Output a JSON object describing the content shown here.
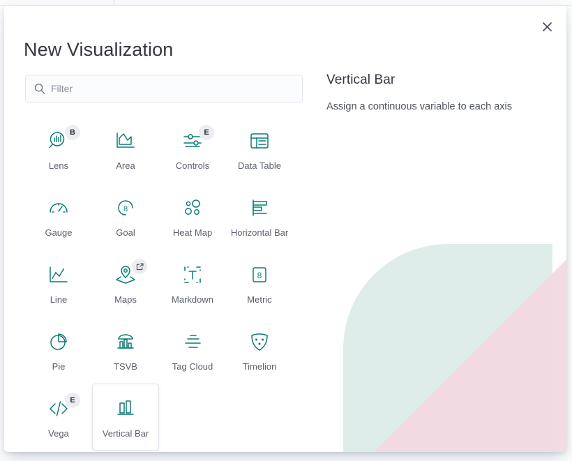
{
  "modal": {
    "title": "New Visualization",
    "close_label": "Close",
    "close_icon": "close-icon"
  },
  "search": {
    "placeholder": "Filter",
    "value": "",
    "icon": "search-icon"
  },
  "detail": {
    "title": "Vertical Bar",
    "description": "Assign a continuous variable to each axis"
  },
  "colors": {
    "accent_teal": "#0b7b72",
    "text_primary": "#343741",
    "text_secondary": "#5a5f6c",
    "badge_bg": "#ecedf1",
    "deco_mint": "#d7e9e4",
    "deco_pink": "#f3d7e0"
  },
  "types": [
    {
      "label": "Lens",
      "icon": "lens-icon",
      "badge": "B",
      "badge_kind": "letter",
      "selected": false
    },
    {
      "label": "Area",
      "icon": "area-icon",
      "badge": null,
      "badge_kind": null,
      "selected": false
    },
    {
      "label": "Controls",
      "icon": "controls-icon",
      "badge": "E",
      "badge_kind": "letter",
      "selected": false
    },
    {
      "label": "Data Table",
      "icon": "data-table-icon",
      "badge": null,
      "badge_kind": null,
      "selected": false
    },
    {
      "label": "Gauge",
      "icon": "gauge-icon",
      "badge": null,
      "badge_kind": null,
      "selected": false
    },
    {
      "label": "Goal",
      "icon": "goal-icon",
      "badge": null,
      "badge_kind": null,
      "selected": false
    },
    {
      "label": "Heat Map",
      "icon": "heat-map-icon",
      "badge": null,
      "badge_kind": null,
      "selected": false
    },
    {
      "label": "Horizontal Bar",
      "icon": "horizontal-bar-icon",
      "badge": null,
      "badge_kind": null,
      "selected": false
    },
    {
      "label": "Line",
      "icon": "line-icon",
      "badge": null,
      "badge_kind": null,
      "selected": false
    },
    {
      "label": "Maps",
      "icon": "maps-icon",
      "badge": "external-link-icon",
      "badge_kind": "icon",
      "selected": false
    },
    {
      "label": "Markdown",
      "icon": "markdown-icon",
      "badge": null,
      "badge_kind": null,
      "selected": false
    },
    {
      "label": "Metric",
      "icon": "metric-icon",
      "badge": null,
      "badge_kind": null,
      "selected": false
    },
    {
      "label": "Pie",
      "icon": "pie-icon",
      "badge": null,
      "badge_kind": null,
      "selected": false
    },
    {
      "label": "TSVB",
      "icon": "tsvb-icon",
      "badge": null,
      "badge_kind": null,
      "selected": false
    },
    {
      "label": "Tag Cloud",
      "icon": "tag-cloud-icon",
      "badge": null,
      "badge_kind": null,
      "selected": false
    },
    {
      "label": "Timelion",
      "icon": "timelion-icon",
      "badge": null,
      "badge_kind": null,
      "selected": false
    },
    {
      "label": "Vega",
      "icon": "vega-icon",
      "badge": "E",
      "badge_kind": "letter",
      "selected": false
    },
    {
      "label": "Vertical Bar",
      "icon": "vertical-bar-icon",
      "badge": null,
      "badge_kind": null,
      "selected": true
    }
  ]
}
